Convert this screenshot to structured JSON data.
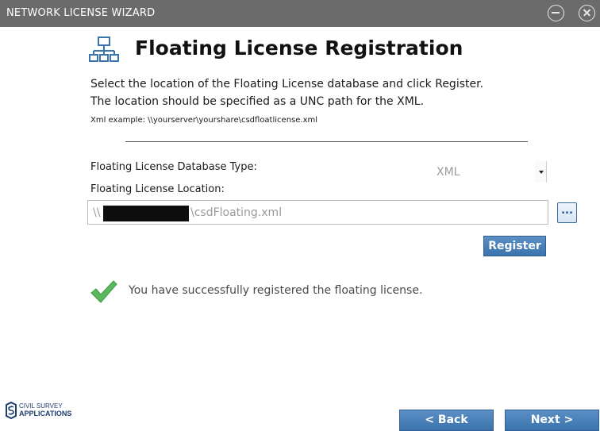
{
  "window": {
    "title": "NETWORK LICENSE WIZARD"
  },
  "page": {
    "heading": "Floating License Registration",
    "instructions": [
      "Select the location of the Floating License database and click Register.",
      "The location should be specified as a UNC path for the XML."
    ],
    "example": "Xml example: \\\\yourserver\\yourshare\\csdfloatlicense.xml"
  },
  "form": {
    "db_type_label": "Floating License Database Type:",
    "db_type_value": "XML",
    "location_label": "Floating License Location:",
    "location_prefix": "\\\\",
    "location_suffix": "\\csdFloating.xml",
    "browse_label": "...",
    "register_label": "Register"
  },
  "status": {
    "message": "You have successfully registered the floating license.",
    "icon": "checkmark-icon",
    "color": "#5cb85c"
  },
  "footer": {
    "logo_line1": "CIVIL SURVEY",
    "logo_line2": "APPLICATIONS",
    "back_label": "< Back",
    "next_label": "Next >"
  },
  "colors": {
    "titlebar": "#6b6b6b",
    "button_blue": "#3b73ad"
  }
}
